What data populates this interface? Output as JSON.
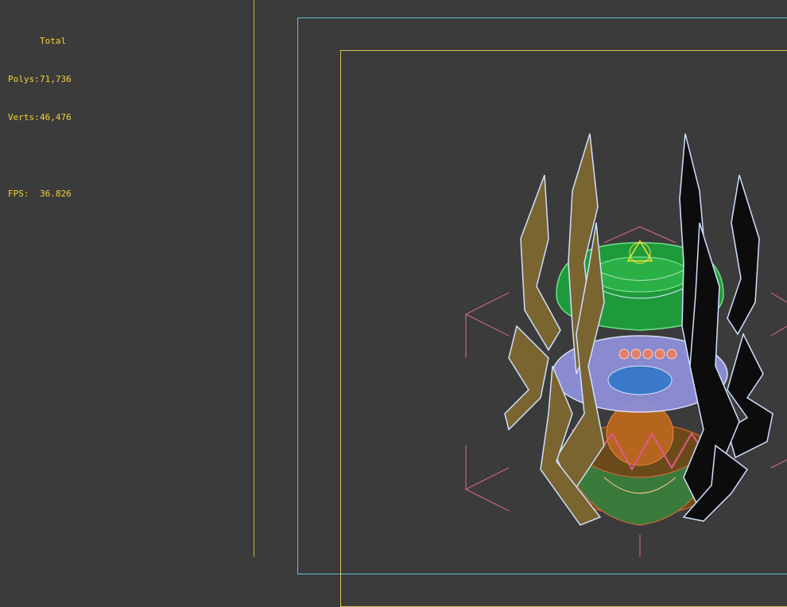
{
  "viewport": {
    "stats": {
      "title": "Total",
      "polys_label": "Polys:",
      "polys_value": "71,736",
      "verts_label": "Verts:",
      "verts_value": "46,476",
      "fps_label": "FPS:",
      "fps_value": "36.826"
    }
  },
  "colors": {
    "background": "#3b3b3b",
    "stats_text": "#f2d33a",
    "frame_cyan": "#5fc3d8",
    "frame_yellow": "#d8c24a",
    "gizmo_pink": "#e06a8a",
    "wire_blue": "#cfe1ff"
  },
  "icons": [
    "pivot-triangle-icon"
  ]
}
